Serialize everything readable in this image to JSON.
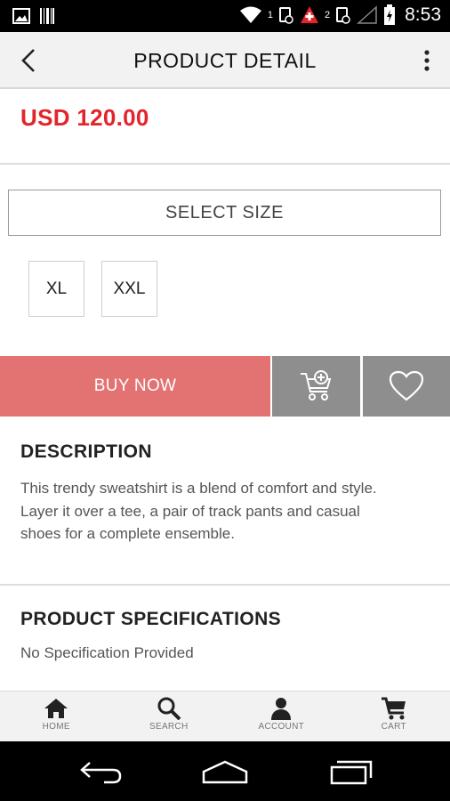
{
  "status_bar": {
    "time": "8:53",
    "sim1_label": "1",
    "sim2_label": "2"
  },
  "app_bar": {
    "title": "PRODUCT DETAIL"
  },
  "product": {
    "price": "USD 120.00"
  },
  "size_selector": {
    "label": "SELECT SIZE",
    "options": [
      "XL",
      "XXL"
    ]
  },
  "actions": {
    "buy_now_label": "BUY NOW"
  },
  "description": {
    "heading": "DESCRIPTION",
    "lines": [
      "This trendy sweatshirt is a blend of comfort and style.",
      "Layer it over a tee, a pair of track pants and casual",
      "shoes for a complete ensemble."
    ]
  },
  "specifications": {
    "heading": "PRODUCT SPECIFICATIONS",
    "text": "No Specification Provided"
  },
  "bottom_nav": {
    "items": [
      {
        "label": "HOME",
        "icon": "home-icon"
      },
      {
        "label": "SEARCH",
        "icon": "search-icon"
      },
      {
        "label": "ACCOUNT",
        "icon": "account-icon"
      },
      {
        "label": "CART",
        "icon": "cart-icon"
      }
    ]
  },
  "colors": {
    "price": "#e3242b",
    "buy_now": "#e37373",
    "icon_button": "#8e8e8e"
  }
}
